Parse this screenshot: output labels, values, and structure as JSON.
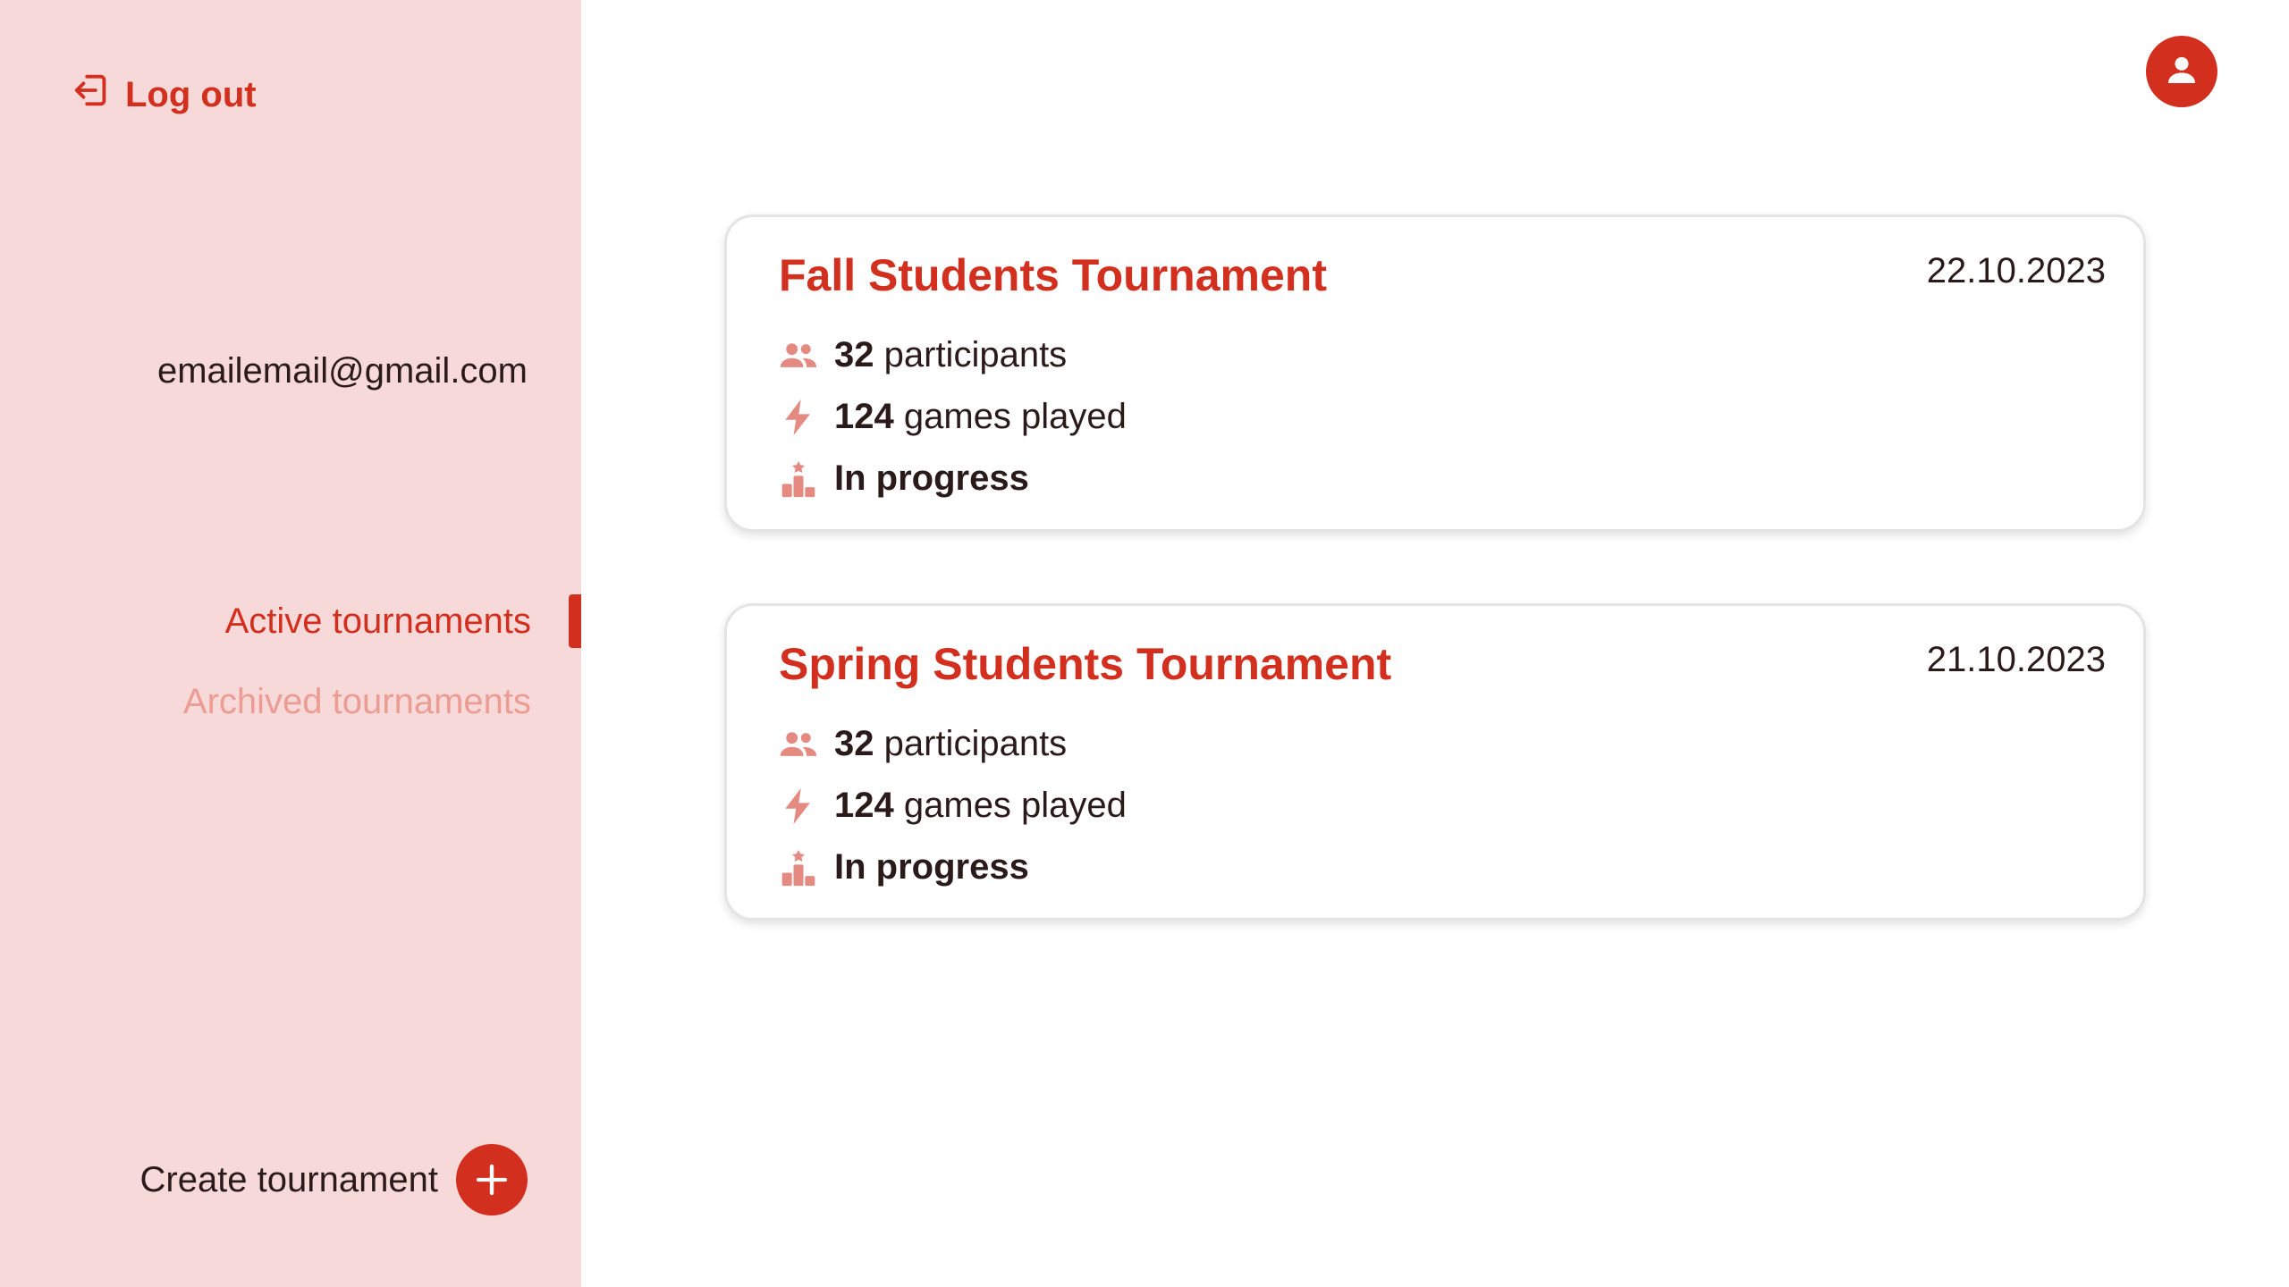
{
  "sidebar": {
    "logout_label": "Log out",
    "email": "emailemail@gmail.com",
    "nav": [
      {
        "label": "Active tournaments",
        "active": true
      },
      {
        "label": "Archived tournaments",
        "active": false
      }
    ],
    "create_label": "Create tournament"
  },
  "icons": {
    "logout": "logout-icon",
    "avatar": "user-icon",
    "create": "plus-icon",
    "participants": "people-icon",
    "games": "lightning-icon",
    "status": "podium-icon"
  },
  "colors": {
    "accent": "#d32f1e",
    "sidebar_bg": "#f7d9d9",
    "inactive_nav": "#eb9c93",
    "icon_muted": "#e48a80"
  },
  "tournaments": [
    {
      "title": "Fall Students Tournament",
      "date": "22.10.2023",
      "participants_count": "32",
      "participants_label": "participants",
      "games_count": "124",
      "games_label": "games played",
      "status": "In progress"
    },
    {
      "title": "Spring Students Tournament",
      "date": "21.10.2023",
      "participants_count": "32",
      "participants_label": "participants",
      "games_count": "124",
      "games_label": "games played",
      "status": "In progress"
    }
  ]
}
